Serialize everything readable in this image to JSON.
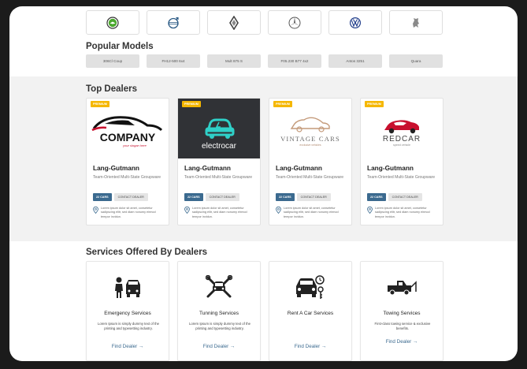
{
  "brands": [
    {
      "name": "skoda-logo",
      "color": "#4ba82e"
    },
    {
      "name": "volvo-logo",
      "color": "#2c5b86"
    },
    {
      "name": "renault-logo",
      "color": "#444444"
    },
    {
      "name": "mercedes-logo",
      "color": "#555555"
    },
    {
      "name": "volkswagen-logo",
      "color": "#1f3c8a"
    },
    {
      "name": "peugeot-logo",
      "color": "#777777"
    }
  ],
  "models": {
    "title": "Popular Models",
    "items": [
      "306Cl Coup",
      "FH12-500 6x4",
      "Mult 875 S",
      "F05.230 B77 4x2",
      "Antos 3251",
      "Quara"
    ]
  },
  "dealers": {
    "title": "Top Dealers",
    "cards": [
      {
        "badge": "PREMIUM",
        "logo_text": "COMPANY",
        "logo_sub": "your slogan here",
        "name": "Lang-Gutmann",
        "desc": "Team-Oriented Multi-State Groupware",
        "cars": "22 CARS",
        "contact": "CONTACT DEALER",
        "address": "Lorem ipsum dolor sit amet, consetetur sadipscing elitr, sed diam nonumy eirmod tempor invidun."
      },
      {
        "badge": "PREMIUM",
        "logo_text": "electrocar",
        "logo_sub": "",
        "name": "Lang-Gutmann",
        "desc": "Team-Oriented Multi-State Groupware",
        "cars": "22 CARS",
        "contact": "CONTACT DEALER",
        "address": "Lorem ipsum dolor sit amet, consetetur sadipscing elitr, sed diam nonumy eirmod tempor invidun."
      },
      {
        "badge": "PREMIUM",
        "logo_text": "VINTAGE CARS",
        "logo_sub": "exclusive vehicles",
        "name": "Lang-Gutmann",
        "desc": "Team-Oriented Multi-State Groupware",
        "cars": "22 CARS",
        "contact": "CONTACT DEALER",
        "address": "Lorem ipsum dolor sit amet, consetetur sadipscing elitr, sed diam nonumy eirmod tempor invidun."
      },
      {
        "badge": "PREMIUM",
        "logo_text": "REDCAR",
        "logo_sub": "speed vehicle",
        "name": "Lang-Gutmann",
        "desc": "Team-Oriented Multi-State Groupware",
        "cars": "22 CARS",
        "contact": "CONTACT DEALER",
        "address": "Lorem ipsum dolor sit amet, consetetur sadipscing elitr, sed diam nonumy eirmod tempor invidun."
      }
    ]
  },
  "services": {
    "title": "Services Offered By Dealers",
    "cards": [
      {
        "icon": "mechanic-car-icon",
        "name": "Emergency Services",
        "desc": "Lorem Ipsum is simply dummy text of the printing and typesetting industry.",
        "link": "Find Dealer"
      },
      {
        "icon": "wrenches-car-icon",
        "name": "Tunning Services",
        "desc": "Lorem Ipsum is simply dummy text of the printing and typesetting industry.",
        "link": "Find Dealer"
      },
      {
        "icon": "car-key-clock-icon",
        "name": "Rent A Car Services",
        "desc": "",
        "link": "Find Dealer"
      },
      {
        "icon": "tow-truck-icon",
        "name": "Towing Services",
        "desc": "First-class towing service & exclusive benefits.",
        "link": "Find Dealer"
      }
    ]
  },
  "colors": {
    "accent": "#3b6a8f",
    "premium": "#f5b700",
    "section_bg": "#f2f2f2"
  }
}
